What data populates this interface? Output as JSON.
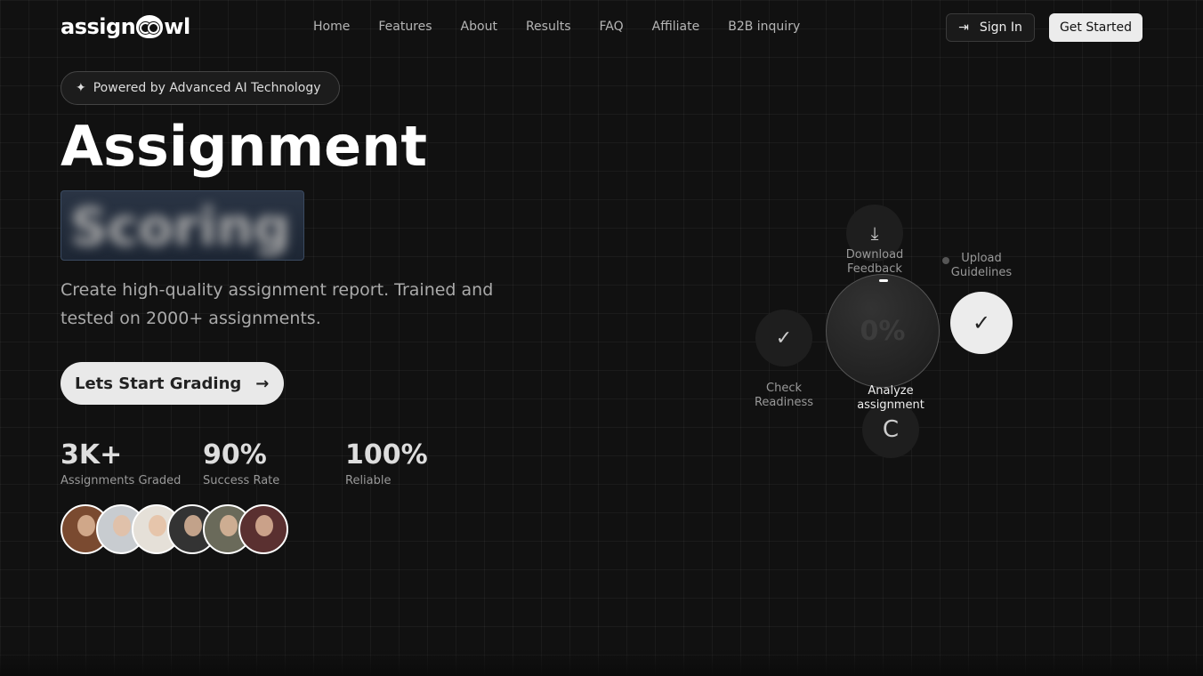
{
  "brand": {
    "name_left": "assign",
    "name_right": "wl"
  },
  "nav": [
    "Home",
    "Features",
    "About",
    "Results",
    "FAQ",
    "Affiliate",
    "B2B inquiry"
  ],
  "header": {
    "sign_in": "Sign In",
    "get_started": "Get Started"
  },
  "hero": {
    "badge": "Powered by Advanced AI Technology",
    "title": "Assignment",
    "rotating_word": "Scoring",
    "description": "Create high-quality assignment report. Trained and tested on 2000+ assignments.",
    "cta": "Lets Start Grading"
  },
  "stats": [
    {
      "value": "3K+",
      "label": "Assignments Graded"
    },
    {
      "value": "90%",
      "label": "Success Rate"
    },
    {
      "value": "100%",
      "label": "Reliable"
    }
  ],
  "workflow": {
    "progress": "0%",
    "steps": {
      "download": "Download Feedback",
      "upload": "Upload Guidelines",
      "check": "Check Readiness",
      "analyze": "Analyze assignment"
    }
  }
}
